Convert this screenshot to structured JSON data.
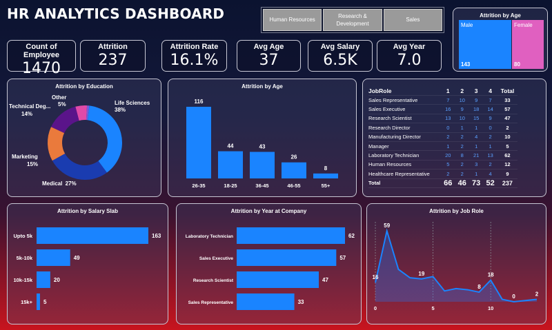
{
  "header": {
    "title": "HR ANALYTICS DASHBOARD"
  },
  "slicer": {
    "options": [
      "Human Resources",
      "Research & Development",
      "Sales"
    ]
  },
  "kpis": [
    {
      "label": "Count of Employee",
      "value": "1470"
    },
    {
      "label": "Attrition",
      "value": "237"
    },
    {
      "label": "Attrition Rate",
      "value": "16.1%"
    },
    {
      "label": "Avg Age",
      "value": "37"
    },
    {
      "label": "Avg Salary",
      "value": "6.5K"
    },
    {
      "label": "Avg Year",
      "value": "7.0"
    }
  ],
  "colors": {
    "bar": "#1a84ff",
    "male": "#1a84ff",
    "female": "#e060c0",
    "line": "#1a84ff",
    "donut": [
      "#1a84ff",
      "#1a3cb0",
      "#ea7a3c",
      "#5a148a",
      "#e04aa8",
      "#7a5ad8"
    ]
  },
  "chart_data": [
    {
      "id": "attrition_by_gender",
      "type": "treemap",
      "title": "Attrition by Age",
      "categories": [
        "Male",
        "Female"
      ],
      "values": [
        143,
        80
      ]
    },
    {
      "id": "attrition_by_education",
      "type": "pie",
      "title": "Attrition by Education",
      "categories": [
        "Life Sciences",
        "Medical",
        "Marketing",
        "Technical Deg...",
        "Other",
        ""
      ],
      "percent_labels": [
        "38%",
        "27%",
        "15%",
        "14%",
        "5%",
        ""
      ],
      "values": [
        38,
        27,
        15,
        14,
        5,
        1
      ]
    },
    {
      "id": "attrition_by_age",
      "type": "bar",
      "title": "Attrition by Age",
      "categories": [
        "26-35",
        "18-25",
        "36-45",
        "46-55",
        "55+"
      ],
      "values": [
        116,
        44,
        43,
        26,
        8
      ],
      "ylim": [
        0,
        116
      ]
    },
    {
      "id": "jobrole_matrix",
      "type": "table",
      "columns": [
        "JobRole",
        "1",
        "2",
        "3",
        "4",
        "Total"
      ],
      "rows": [
        [
          "Sales Representative",
          "7",
          "10",
          "9",
          "7",
          "33"
        ],
        [
          "Sales Executive",
          "16",
          "9",
          "18",
          "14",
          "57"
        ],
        [
          "Research Scientist",
          "13",
          "10",
          "15",
          "9",
          "47"
        ],
        [
          "Research Director",
          "0",
          "1",
          "1",
          "0",
          "2"
        ],
        [
          "Manufacturing Director",
          "2",
          "2",
          "4",
          "2",
          "10"
        ],
        [
          "Manager",
          "1",
          "2",
          "1",
          "1",
          "5"
        ],
        [
          "Laboratory Technician",
          "20",
          "8",
          "21",
          "13",
          "62"
        ],
        [
          "Human Resources",
          "5",
          "2",
          "3",
          "2",
          "12"
        ],
        [
          "Healthcare Representative",
          "2",
          "2",
          "1",
          "4",
          "9"
        ]
      ],
      "total": [
        "Total",
        "66",
        "46",
        "73",
        "52",
        "237"
      ]
    },
    {
      "id": "attrition_by_salary_slab",
      "type": "bar",
      "orientation": "horizontal",
      "title": "Attrition by Salary Slab",
      "categories": [
        "Upto 5k",
        "5k-10k",
        "10k-15k",
        "15k+"
      ],
      "values": [
        163,
        49,
        20,
        5
      ],
      "xlim": [
        0,
        163
      ]
    },
    {
      "id": "attrition_by_year_at_company",
      "type": "bar",
      "orientation": "horizontal",
      "title": "Attrition by Year at Company",
      "categories": [
        "Laboratory Technician",
        "Sales Executive",
        "Research Scientist",
        "Sales Representative"
      ],
      "values": [
        62,
        57,
        47,
        33
      ],
      "xlim": [
        0,
        62
      ]
    },
    {
      "id": "attrition_by_job_role",
      "type": "area",
      "title": "Attrition by Job Role",
      "x": [
        0,
        1,
        2,
        3,
        4,
        5,
        6,
        7,
        8,
        9,
        10,
        11,
        12,
        13,
        14
      ],
      "values": [
        16,
        59,
        27,
        20,
        19,
        21,
        9,
        11,
        10,
        8,
        18,
        2,
        0,
        1,
        2
      ],
      "labeled_points": [
        0,
        1,
        4,
        9,
        10,
        12,
        14
      ],
      "x_ticks": [
        "0",
        "5",
        "10"
      ],
      "ylim": [
        0,
        62
      ],
      "xlim": [
        0,
        14
      ]
    }
  ]
}
